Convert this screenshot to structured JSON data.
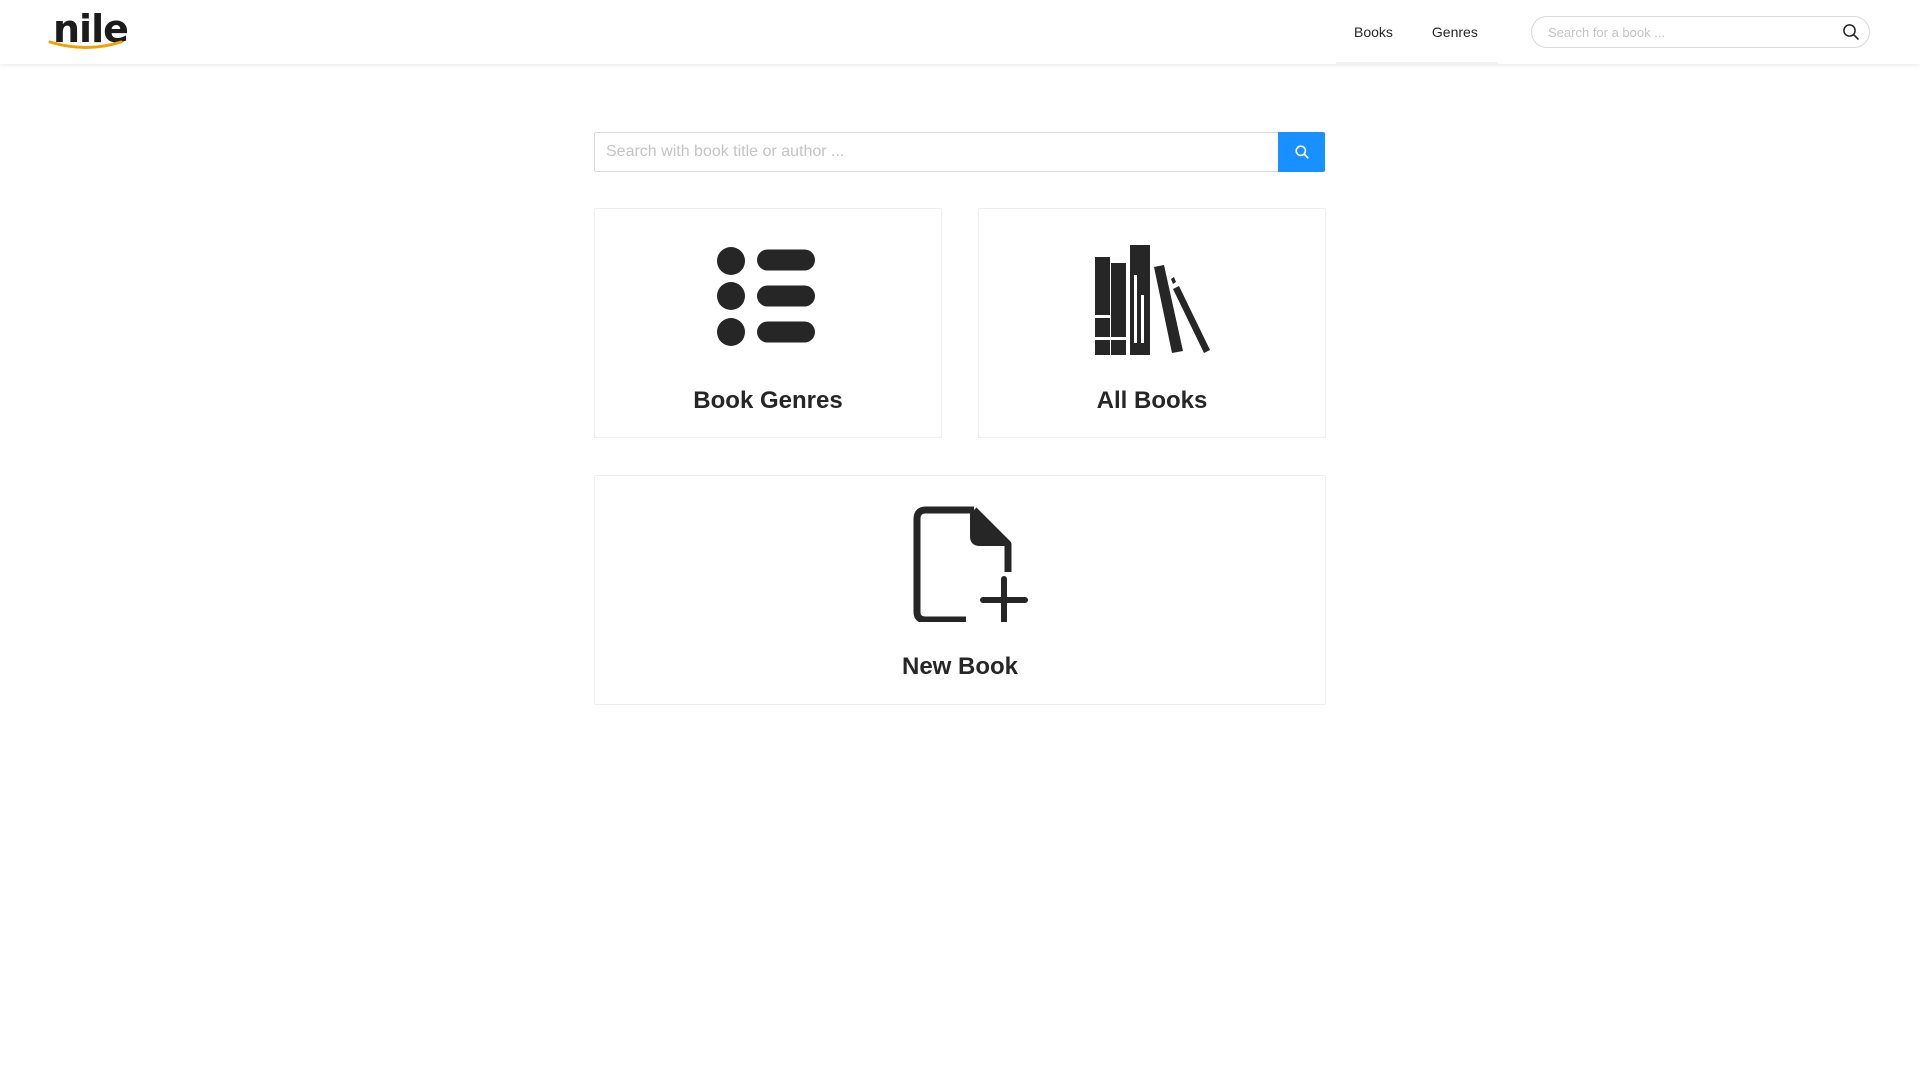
{
  "header": {
    "logo_text": "nile",
    "nav": [
      {
        "label": "Books"
      },
      {
        "label": "Genres"
      }
    ],
    "search": {
      "placeholder": "Search for a book ...",
      "value": ""
    }
  },
  "main": {
    "search": {
      "placeholder": "Search with book title or author ...",
      "value": ""
    },
    "cards": [
      {
        "title": "Book Genres",
        "icon": "list-icon"
      },
      {
        "title": "All Books",
        "icon": "bookshelf-icon"
      },
      {
        "title": "New Book",
        "icon": "file-add-icon"
      }
    ]
  },
  "colors": {
    "accent": "#1890ff",
    "logo_smile": "#f0a202",
    "text": "#262626",
    "border": "#eeeeee"
  }
}
